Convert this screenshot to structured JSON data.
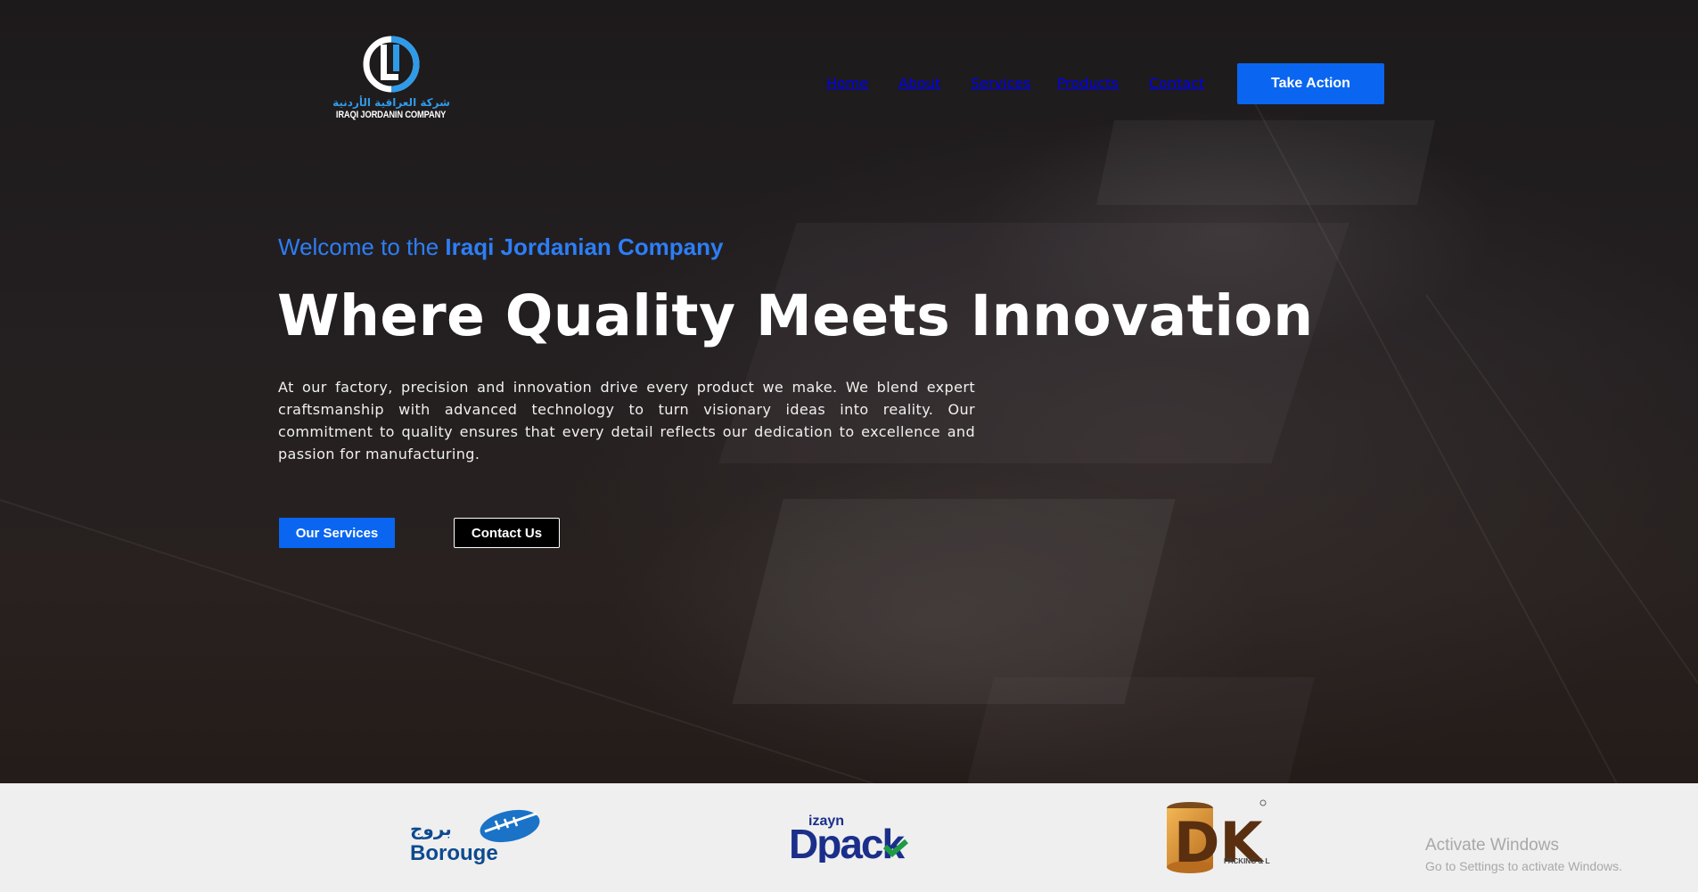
{
  "header": {
    "logo": {
      "arabic_name": "شركة العراقية الأردنية",
      "english_name": "IRAQI JORDANIN COMPANY"
    },
    "nav": [
      "Home",
      "About",
      "Services",
      "Products",
      "Contact"
    ],
    "cta_label": "Take Action"
  },
  "hero": {
    "welcome_prefix": "Welcome to the",
    "welcome_company": "Iraqi Jordanian Company",
    "headline": "Where Quality Meets Innovation",
    "paragraph": "At our factory, precision and innovation drive every product we make. We blend expert craftsmanship with advanced technology to turn visionary ideas into reality. Our commitment to quality ensures that every detail reflects our dedication to excellence and passion for manufacturing.",
    "primary_button": "Our Services",
    "secondary_button": "Contact Us"
  },
  "partners": [
    {
      "name": "Borouge",
      "arabic": "بروج"
    },
    {
      "name": "Dpack",
      "prefix": "izayn"
    },
    {
      "name": "DK",
      "subtitle": "PACKING & LABEL"
    }
  ],
  "watermark": {
    "title": "Activate Windows",
    "subtitle": "Go to Settings to activate Windows."
  },
  "colors": {
    "accent": "#0a66f0",
    "welcome_text": "#2d7ef5",
    "partner_strip": "#efefef"
  }
}
